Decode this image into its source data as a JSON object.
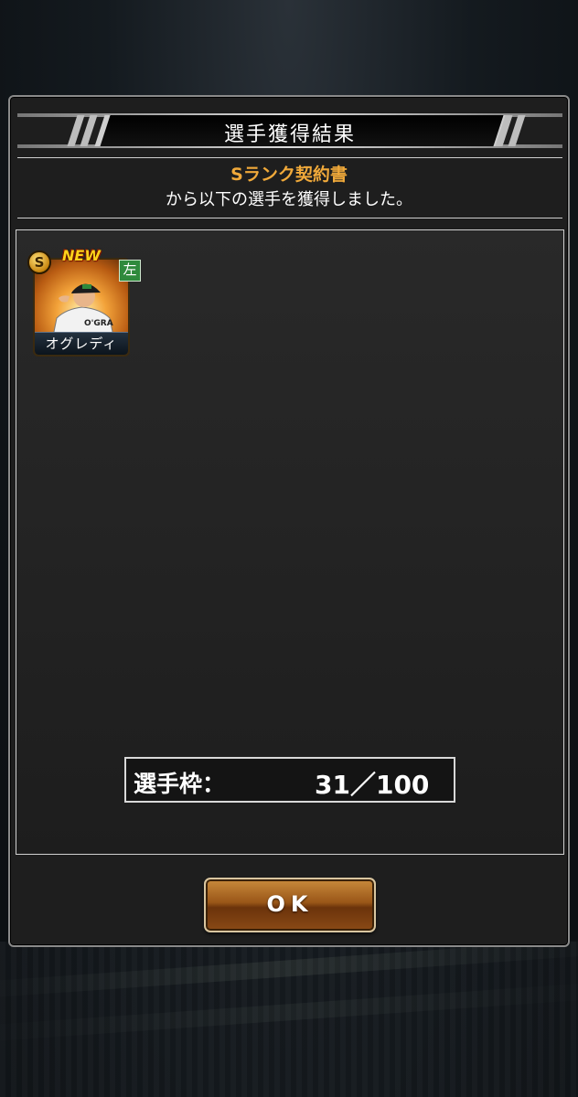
{
  "dialog": {
    "title": "選手獲得結果",
    "message_highlight": "Sランク契約書",
    "message_text": "から以下の選手を獲得しました。"
  },
  "player": {
    "rank": "S",
    "new_label": "NEW",
    "hand": "左",
    "name": "オグレディ"
  },
  "roster": {
    "label": "選手枠：",
    "value": "31／100"
  },
  "ok_button": {
    "label": "OK"
  },
  "colors": {
    "highlight": "#f0a93a",
    "panel_bg": "#1e1e1e",
    "button_brown": "#9a5718",
    "hand_badge_green": "#2f8a3c"
  },
  "icons": {
    "rank": "rank-s-coin-icon",
    "hand": "left-handed-badge-icon"
  }
}
